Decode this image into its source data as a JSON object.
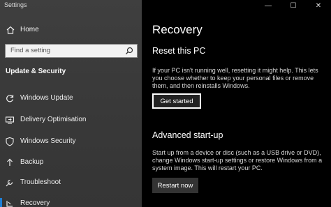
{
  "window": {
    "title": "Settings",
    "minimize_glyph": "—",
    "maximize_glyph": "☐",
    "close_glyph": "✕"
  },
  "sidebar": {
    "home_label": "Home",
    "search_placeholder": "Find a setting",
    "section_title": "Update & Security",
    "items": [
      {
        "label": "Windows Update",
        "icon": "refresh-icon"
      },
      {
        "label": "Delivery Optimisation",
        "icon": "delivery-optimisation-icon"
      },
      {
        "label": "Windows Security",
        "icon": "shield-icon"
      },
      {
        "label": "Backup",
        "icon": "backup-arrow-icon"
      },
      {
        "label": "Troubleshoot",
        "icon": "wrench-icon"
      },
      {
        "label": "Recovery",
        "icon": "recovery-icon",
        "selected": true
      }
    ]
  },
  "main": {
    "page_title": "Recovery",
    "reset": {
      "heading": "Reset this PC",
      "description": "If your PC isn't running well, resetting it might help. This lets you choose whether to keep your personal files or remove them, and then reinstalls Windows.",
      "button_label": "Get started"
    },
    "advanced": {
      "heading": "Advanced start-up",
      "description": "Start up from a device or disc (such as a USB drive or DVD), change Windows start-up settings or restore Windows from a system image. This will restart your PC.",
      "button_label": "Restart now"
    }
  },
  "colors": {
    "accent": "#1e7fd6",
    "sidebar_bg": "#3a3a3a",
    "main_bg": "#000000"
  }
}
